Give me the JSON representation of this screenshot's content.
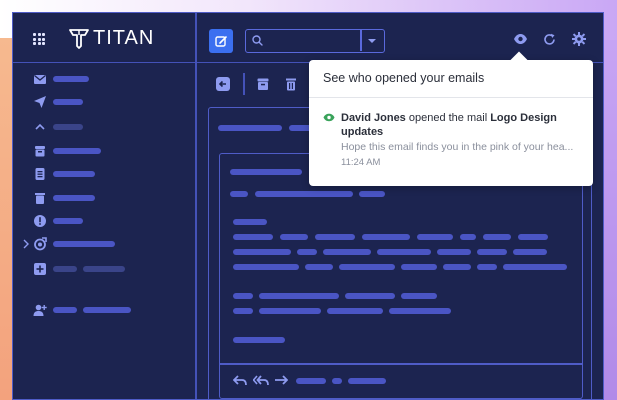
{
  "app": {
    "brand": "TITAN"
  },
  "colors": {
    "accent": "#3b6ff0",
    "panel_bg": "#1c2450",
    "placeholder_bar": "#4a55c4",
    "read_indicator": "#3aa35b"
  },
  "topbar": {
    "search_placeholder": "",
    "icons": [
      "apps-grid-icon",
      "compose-icon",
      "search-icon",
      "chevron-down-icon",
      "eye-icon",
      "refresh-icon",
      "gear-icon"
    ]
  },
  "sidebar": {
    "icons": [
      "inbox-icon",
      "send-icon",
      "chevron-up-icon",
      "archive-icon",
      "document-icon",
      "trash-icon",
      "alert-icon",
      "custom-folder-icon",
      "add-folder-icon",
      "add-contact-icon"
    ]
  },
  "toolbar": {
    "icons": [
      "back-icon",
      "archive-icon",
      "trash-icon"
    ]
  },
  "read_receipts": {
    "title": "See who opened your emails",
    "events": [
      {
        "name": "David Jones",
        "action": " opened the mail ",
        "subject": "Logo Design updates",
        "preview": "Hope this email finds you in the pink of your hea...",
        "time": "11:24 AM"
      }
    ]
  },
  "message_footer": {
    "icons": [
      "reply-icon",
      "reply-all-icon",
      "forward-icon"
    ]
  }
}
